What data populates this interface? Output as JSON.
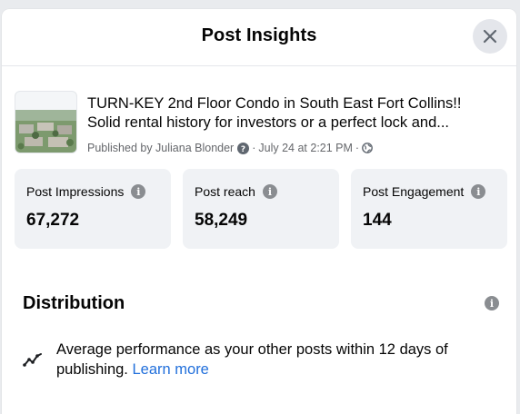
{
  "dialog": {
    "title": "Post Insights",
    "close_icon": "close-icon"
  },
  "post": {
    "thumbnail_icon": "aerial-photo-thumbnail",
    "line1": "TURN-KEY 2nd Floor Condo in South East Fort Collins!!",
    "line2": "Solid rental history for investors or a perfect lock and...",
    "published_by": "Published by Juliana Blonder",
    "author_info_icon": "question-icon",
    "date": "July 24 at 2:21 PM",
    "separator": "·",
    "audience_icon": "globe-icon"
  },
  "metrics": [
    {
      "label": "Post Impressions",
      "value": "67,272",
      "icon": "info-icon"
    },
    {
      "label": "Post reach",
      "value": "58,249",
      "icon": "info-icon"
    },
    {
      "label": "Post Engagement",
      "value": "144",
      "icon": "info-icon"
    }
  ],
  "distribution": {
    "title": "Distribution",
    "info_icon": "info-icon",
    "trend_icon": "trend-line-icon",
    "text": "Average performance as your other posts within 12 days of publishing.",
    "link": "Learn more"
  },
  "colors": {
    "accent_link": "#216fdb",
    "card_bg": "#f0f2f5",
    "secondary_text": "#65676b"
  }
}
